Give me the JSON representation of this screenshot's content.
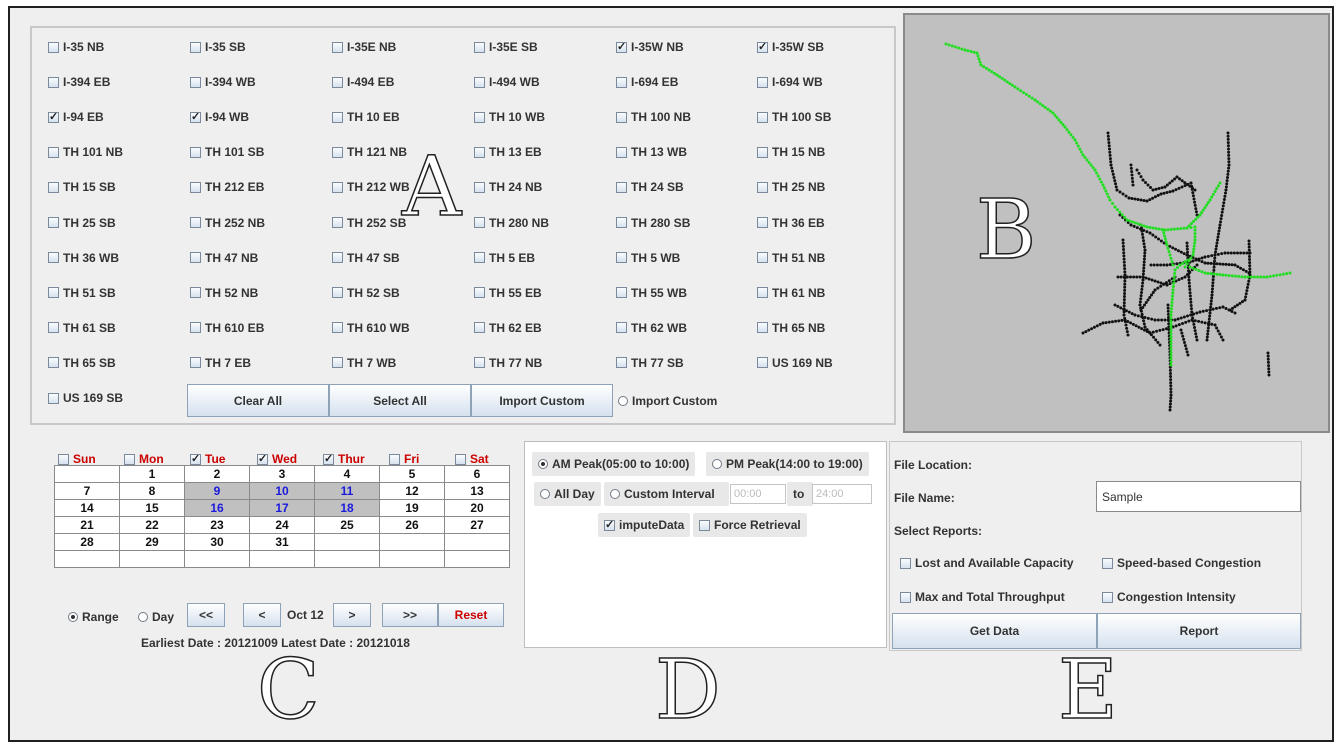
{
  "routes": [
    {
      "label": "I-35 NB",
      "checked": false
    },
    {
      "label": "I-35 SB",
      "checked": false
    },
    {
      "label": "I-35E NB",
      "checked": false
    },
    {
      "label": "I-35E SB",
      "checked": false
    },
    {
      "label": "I-35W NB",
      "checked": true
    },
    {
      "label": "I-35W SB",
      "checked": true
    },
    {
      "label": "I-394 EB",
      "checked": false
    },
    {
      "label": "I-394 WB",
      "checked": false
    },
    {
      "label": "I-494 EB",
      "checked": false
    },
    {
      "label": "I-494 WB",
      "checked": false
    },
    {
      "label": "I-694 EB",
      "checked": false
    },
    {
      "label": "I-694 WB",
      "checked": false
    },
    {
      "label": "I-94 EB",
      "checked": true
    },
    {
      "label": "I-94 WB",
      "checked": true
    },
    {
      "label": "TH 10 EB",
      "checked": false
    },
    {
      "label": "TH 10 WB",
      "checked": false
    },
    {
      "label": "TH 100 NB",
      "checked": false
    },
    {
      "label": "TH 100 SB",
      "checked": false
    },
    {
      "label": "TH 101 NB",
      "checked": false
    },
    {
      "label": "TH 101 SB",
      "checked": false
    },
    {
      "label": "TH 121 NB",
      "checked": false
    },
    {
      "label": "TH 13 EB",
      "checked": false
    },
    {
      "label": "TH 13 WB",
      "checked": false
    },
    {
      "label": "TH 15 NB",
      "checked": false
    },
    {
      "label": "TH 15 SB",
      "checked": false
    },
    {
      "label": "TH 212 EB",
      "checked": false
    },
    {
      "label": "TH 212 WB",
      "checked": false
    },
    {
      "label": "TH 24 NB",
      "checked": false
    },
    {
      "label": "TH 24 SB",
      "checked": false
    },
    {
      "label": "TH 25 NB",
      "checked": false
    },
    {
      "label": "TH 25 SB",
      "checked": false
    },
    {
      "label": "TH 252 NB",
      "checked": false
    },
    {
      "label": "TH 252 SB",
      "checked": false
    },
    {
      "label": "TH 280 NB",
      "checked": false
    },
    {
      "label": "TH 280 SB",
      "checked": false
    },
    {
      "label": "TH 36 EB",
      "checked": false
    },
    {
      "label": "TH 36 WB",
      "checked": false
    },
    {
      "label": "TH 47 NB",
      "checked": false
    },
    {
      "label": "TH 47 SB",
      "checked": false
    },
    {
      "label": "TH 5 EB",
      "checked": false
    },
    {
      "label": "TH 5 WB",
      "checked": false
    },
    {
      "label": "TH 51 NB",
      "checked": false
    },
    {
      "label": "TH 51 SB",
      "checked": false
    },
    {
      "label": "TH 52 NB",
      "checked": false
    },
    {
      "label": "TH 52 SB",
      "checked": false
    },
    {
      "label": "TH 55 EB",
      "checked": false
    },
    {
      "label": "TH 55 WB",
      "checked": false
    },
    {
      "label": "TH 61 NB",
      "checked": false
    },
    {
      "label": "TH 61 SB",
      "checked": false
    },
    {
      "label": "TH 610 EB",
      "checked": false
    },
    {
      "label": "TH 610 WB",
      "checked": false
    },
    {
      "label": "TH 62 EB",
      "checked": false
    },
    {
      "label": "TH 62 WB",
      "checked": false
    },
    {
      "label": "TH 65 NB",
      "checked": false
    },
    {
      "label": "TH 65 SB",
      "checked": false
    },
    {
      "label": "TH 7 EB",
      "checked": false
    },
    {
      "label": "TH 7 WB",
      "checked": false
    },
    {
      "label": "TH 77 NB",
      "checked": false
    },
    {
      "label": "TH 77 SB",
      "checked": false
    },
    {
      "label": "US 169 NB",
      "checked": false
    },
    {
      "label": "US 169 SB",
      "checked": false
    }
  ],
  "panelA": {
    "clear_all": "Clear All",
    "select_all": "Select All",
    "import_custom_button": "Import Custom",
    "import_custom_radio": "Import Custom"
  },
  "letters": {
    "a": "A",
    "b": "B",
    "c": "C",
    "d": "D",
    "e": "E"
  },
  "map": {
    "selected_color": "#22dd22",
    "unselected_color": "#111111",
    "background": "#c0c0c0"
  },
  "calendar": {
    "days": [
      {
        "label": "Sun",
        "checked": false
      },
      {
        "label": "Mon",
        "checked": false
      },
      {
        "label": "Tue",
        "checked": true
      },
      {
        "label": "Wed",
        "checked": true
      },
      {
        "label": "Thur",
        "checked": true
      },
      {
        "label": "Fri",
        "checked": false
      },
      {
        "label": "Sat",
        "checked": false
      }
    ],
    "rows": [
      [
        "",
        "1",
        "2",
        "3",
        "4",
        "5",
        "6"
      ],
      [
        "7",
        "8",
        "9",
        "10",
        "11",
        "12",
        "13"
      ],
      [
        "14",
        "15",
        "16",
        "17",
        "18",
        "19",
        "20"
      ],
      [
        "21",
        "22",
        "23",
        "24",
        "25",
        "26",
        "27"
      ],
      [
        "28",
        "29",
        "30",
        "31",
        "",
        "",
        ""
      ],
      [
        "",
        "",
        "",
        "",
        "",
        "",
        ""
      ]
    ],
    "selected_dates": [
      "9",
      "10",
      "11",
      "16",
      "17",
      "18"
    ],
    "range_label": "Range",
    "day_label": "Day",
    "first_btn": "<<",
    "prev_btn": "<",
    "month_label": "Oct 12",
    "next_btn": ">",
    "last_btn": ">>",
    "reset_btn": "Reset",
    "reset_color": "#cc0000",
    "earliest_label": "Earliest Date :",
    "earliest_value": "20121009",
    "latest_label": "Latest Date :",
    "latest_value": "20121018"
  },
  "time": {
    "am_peak": "AM Peak(05:00 to 10:00)",
    "pm_peak": "PM Peak(14:00 to 19:00)",
    "all_day": "All Day",
    "custom_interval": "Custom Interval",
    "start_value": "00:00",
    "to_label": "to",
    "end_value": "24:00",
    "impute_data": "imputeData",
    "force_retrieval": "Force Retrieval"
  },
  "report": {
    "file_location_label": "File Location:",
    "file_name_label": "File Name:",
    "file_name_value": "Sample",
    "select_reports_label": "Select Reports:",
    "lost_capacity": "Lost and Available Capacity",
    "speed_congestion": "Speed-based Congestion",
    "max_throughput": "Max and Total Throughput",
    "congestion_intensity": "Congestion Intensity",
    "get_data": "Get Data",
    "report_btn": "Report"
  }
}
